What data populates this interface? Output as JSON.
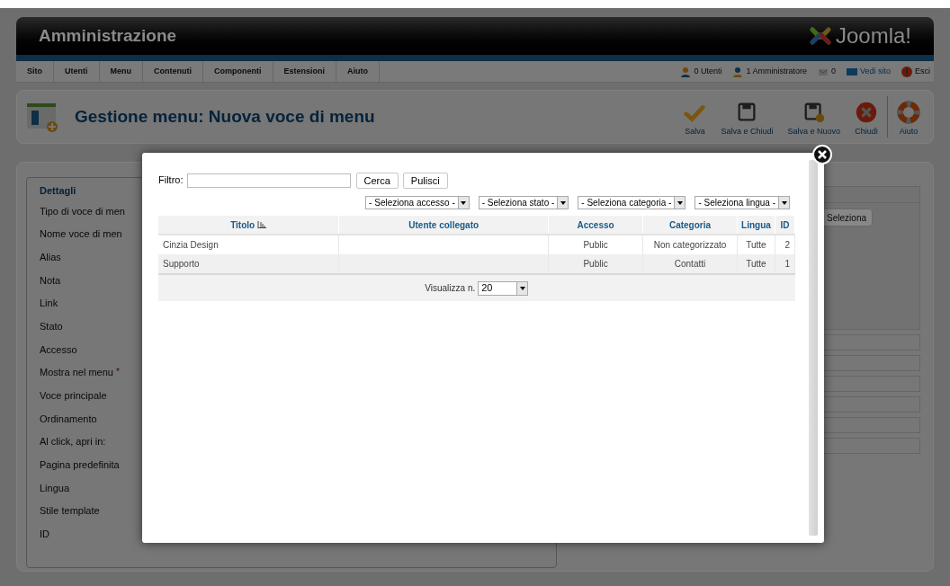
{
  "header": {
    "title": "Amministrazione",
    "logo_text": "Joomla!"
  },
  "menu": {
    "items": [
      "Sito",
      "Utenti",
      "Menu",
      "Contenuti",
      "Componenti",
      "Estensioni",
      "Aiuto"
    ]
  },
  "status": [
    {
      "kind": "users",
      "text": "0 Utenti"
    },
    {
      "kind": "admin",
      "text": "1 Amministratore"
    },
    {
      "kind": "messages",
      "text": "0"
    },
    {
      "kind": "site",
      "text": "Vedi sito"
    },
    {
      "kind": "logout",
      "text": "Esci"
    }
  ],
  "page_title": "Gestione menu: Nuova voce di menu",
  "toolbar": [
    {
      "kind": "save",
      "label": "Salva"
    },
    {
      "kind": "save-close",
      "label": "Salva e Chiudi"
    },
    {
      "kind": "save-new",
      "label": "Salva e Nuovo"
    },
    {
      "kind": "close",
      "label": "Chiudi"
    },
    {
      "kind": "help",
      "label": "Aiuto"
    }
  ],
  "details": {
    "legend": "Dettagli",
    "fields": [
      {
        "label": "Tipo di voce di men"
      },
      {
        "label": "Nome voce di men"
      },
      {
        "label": "Alias"
      },
      {
        "label": "Nota"
      },
      {
        "label": "Link"
      },
      {
        "label": "Stato"
      },
      {
        "label": "Accesso"
      },
      {
        "label": "Mostra nel menu",
        "required_mark": "*"
      },
      {
        "label": "Voce principale"
      },
      {
        "label": "Ordinamento"
      },
      {
        "label": "Al click, apri in:"
      },
      {
        "label": "Pagina predefinita"
      },
      {
        "label": "Lingua"
      },
      {
        "label": "Stile template"
      },
      {
        "label": "ID"
      }
    ],
    "select_button": "Seleziona"
  },
  "modal": {
    "filter_label": "Filtro:",
    "buttons": [
      "Cerca",
      "Pulisci"
    ],
    "selects": [
      "- Seleziona accesso -",
      "- Seleziona stato -",
      "- Seleziona categoria -",
      "- Seleziona lingua -"
    ],
    "columns": [
      {
        "label": "Titolo",
        "sorted": true
      },
      {
        "label": "Utente collegato",
        "sorted": false
      },
      {
        "label": "Accesso",
        "sorted": false
      },
      {
        "label": "Categoria",
        "sorted": false
      },
      {
        "label": "Lingua",
        "sorted": false
      },
      {
        "label": "ID",
        "sorted": false
      }
    ],
    "rows": [
      [
        "Cinzia Design",
        "",
        "Public",
        "Non categorizzato",
        "Tutte",
        "2"
      ],
      [
        "Supporto",
        "",
        "Public",
        "Contatti",
        "Tutte",
        "1"
      ]
    ],
    "pagination": {
      "label": "Visualizza n.",
      "value": "20"
    }
  }
}
